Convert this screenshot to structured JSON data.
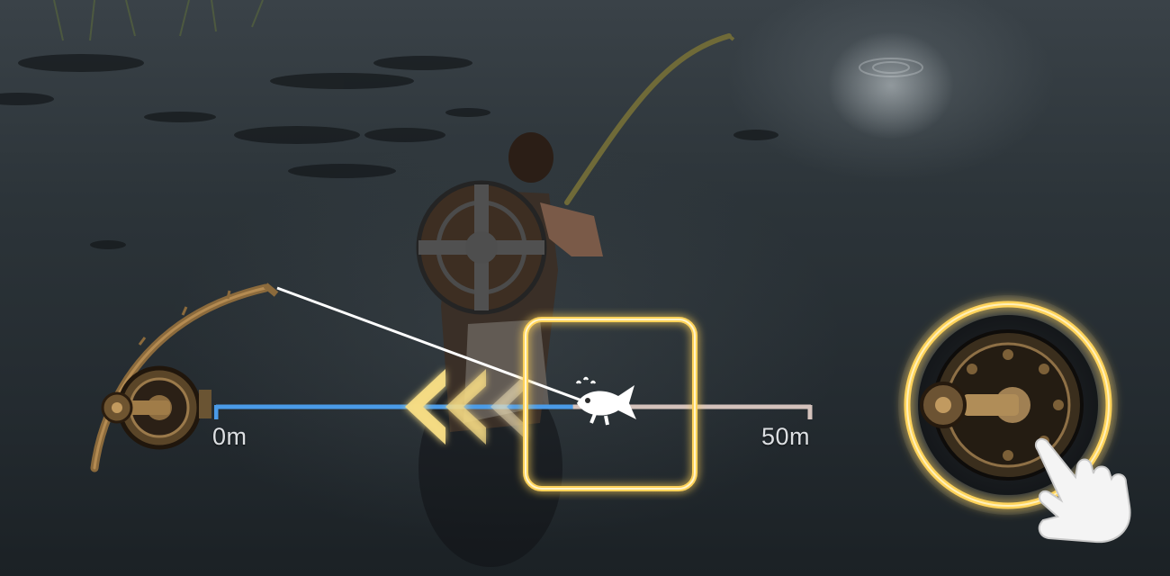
{
  "distance_bar": {
    "start_label": "0m",
    "end_label": "50m",
    "max_distance_m": 50,
    "fish_position_fraction": 0.6,
    "colors": {
      "reeled": "#4a9be8",
      "remaining": "#d4c2bc",
      "accent_gold": "#f3c84a"
    }
  },
  "icons": {
    "rod": "fishing-rod-icon",
    "fish": "fish-icon",
    "reel_direction": "double-chevron-left-icon",
    "reel_button": "reel-icon",
    "tutorial_hand": "pointing-hand-icon"
  }
}
